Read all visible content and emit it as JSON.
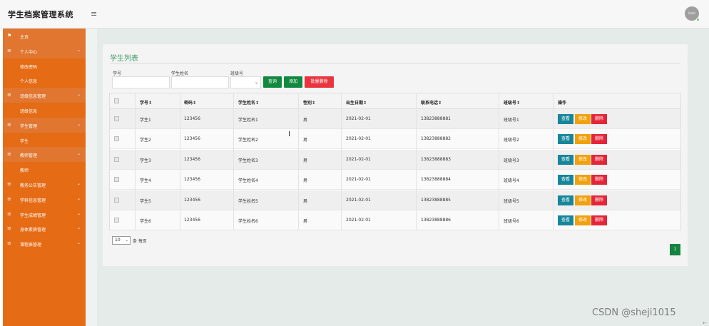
{
  "app": {
    "title": "学生档案管理系统",
    "toggle_glyph": "≡",
    "avatar_text": "lhalli"
  },
  "sidebar": {
    "items": [
      {
        "label": "主页",
        "icon": "flag-icon",
        "glyph": "⚑",
        "type": "group",
        "chevron": ""
      },
      {
        "label": "个人中心",
        "icon": "menu-icon",
        "glyph": "≡",
        "type": "group",
        "chevron": "⌄"
      },
      {
        "label": "修改密码",
        "icon": "",
        "glyph": "",
        "type": "sub",
        "chevron": ""
      },
      {
        "label": "个人信息",
        "icon": "",
        "glyph": "",
        "type": "sub",
        "chevron": ""
      },
      {
        "label": "班级信息管理",
        "icon": "menu-icon",
        "glyph": "≡",
        "type": "group",
        "chevron": "⌄"
      },
      {
        "label": "班级信息",
        "icon": "",
        "glyph": "",
        "type": "sub",
        "chevron": ""
      },
      {
        "label": "学生管理",
        "icon": "menu-icon",
        "glyph": "≡",
        "type": "group",
        "chevron": "⌄"
      },
      {
        "label": "学生",
        "icon": "",
        "glyph": "",
        "type": "sub",
        "chevron": ""
      },
      {
        "label": "教师管理",
        "icon": "menu-icon",
        "glyph": "≡",
        "type": "group",
        "chevron": "⌄"
      },
      {
        "label": "教师",
        "icon": "",
        "glyph": "",
        "type": "sub",
        "chevron": ""
      },
      {
        "label": "教务公告管理",
        "icon": "menu-icon",
        "glyph": "≡",
        "type": "sub",
        "chevron": "⌄"
      },
      {
        "label": "学科信息管理",
        "icon": "menu-icon",
        "glyph": "≡",
        "type": "sub",
        "chevron": "⌄"
      },
      {
        "label": "学生成绩管理",
        "icon": "menu-icon",
        "glyph": "≡",
        "type": "sub",
        "chevron": "⌄"
      },
      {
        "label": "身体素质管理",
        "icon": "menu-icon",
        "glyph": "≡",
        "type": "sub",
        "chevron": "⌄"
      },
      {
        "label": "课程表管理",
        "icon": "menu-icon",
        "glyph": "≡",
        "type": "sub",
        "chevron": "⌄"
      }
    ]
  },
  "card": {
    "title": "学生列表"
  },
  "search": {
    "xuehao_label": "学号",
    "xuehao_value": "",
    "name_label": "学生姓名",
    "name_value": "",
    "class_label": "班级号",
    "class_value": "",
    "query_btn": "查询",
    "add_btn": "添加",
    "batch_delete_btn": "批量删除"
  },
  "table": {
    "columns": [
      "学号⇕",
      "密码⇕",
      "学生姓名⇕",
      "性别⇕",
      "出生日期⇕",
      "联系电话⇕",
      "班级号⇕",
      "操作"
    ],
    "rows": [
      [
        "学生1",
        "123456",
        "学生姓名1",
        "男",
        "2021-02-01",
        "13823888881",
        "班级号1"
      ],
      [
        "学生2",
        "123456",
        "学生姓名2",
        "男",
        "2021-02-01",
        "13823888882",
        "班级号2"
      ],
      [
        "学生3",
        "123456",
        "学生姓名3",
        "男",
        "2021-02-01",
        "13823888883",
        "班级号3"
      ],
      [
        "学生4",
        "123456",
        "学生姓名4",
        "男",
        "2021-02-01",
        "13823888884",
        "班级号4"
      ],
      [
        "学生5",
        "123456",
        "学生姓名5",
        "男",
        "2021-02-01",
        "13823888885",
        "班级号5"
      ],
      [
        "学生6",
        "123456",
        "学生姓名6",
        "男",
        "2021-02-01",
        "13823888886",
        "班级号6"
      ]
    ],
    "actions": {
      "view": "查看",
      "edit": "修改",
      "delete": "删除"
    }
  },
  "pager": {
    "page_size": "10",
    "page_size_suffix": "条 每页",
    "current_page": "1"
  },
  "watermark": "CSDN @sheji1015",
  "colors": {
    "sidebar": "#e56b15",
    "title_green": "#3c9b63",
    "btn_green": "#13893f",
    "btn_red": "#e8353e",
    "view_teal": "#17869b",
    "edit_orange": "#f0a10e",
    "delete_red": "#e42538"
  }
}
